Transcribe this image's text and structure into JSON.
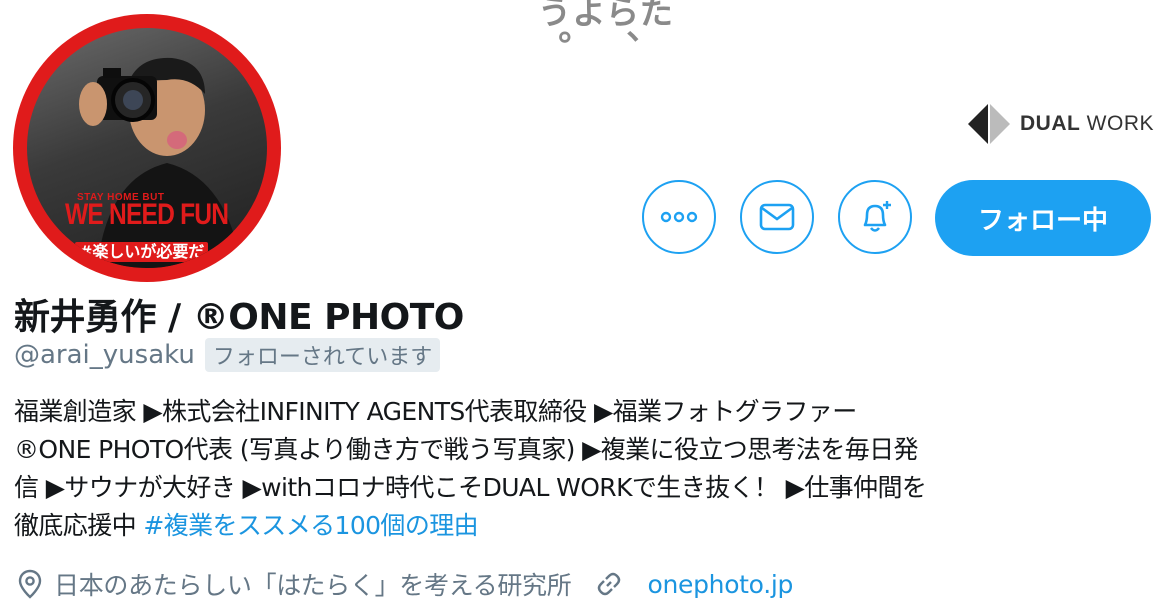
{
  "banner": {
    "col1": "たら、",
    "col2": "よう。",
    "brand_bold": "DUAL",
    "brand_light": "WORK"
  },
  "avatar": {
    "small_text": "STAY HOME BUT",
    "big_text": "WE NEED FUN",
    "tag_text": "#楽しいが必要だ",
    "ring_color": "#e01b1b"
  },
  "actions": {
    "more_icon": "more-icon",
    "message_icon": "mail-icon",
    "notify_icon": "bell-plus-icon",
    "follow_label": "フォロー中",
    "accent_color": "#1da1f2"
  },
  "profile": {
    "name": "新井勇作 / ®ONE PHOTO",
    "handle": "@arai_yusaku",
    "follows_you": "フォローされています",
    "bio_lines": [
      "福業創造家 ▶株式会社INFINITY AGENTS代表取締役 ▶福業フォトグラファー",
      "®ONE PHOTO代表 (写真より働き方で戦う写真家) ▶複業に役立つ思考法を毎日発",
      "信 ▶サウナが大好き ▶withコロナ時代こそDUAL WORKで生き抜く！ ▶仕事仲間を",
      "徹底応援中 "
    ],
    "hashtag": "#複業をススメる100個の理由",
    "location": "日本のあたらしい「はたらく」を考える研究所",
    "url": "onephoto.jp"
  }
}
